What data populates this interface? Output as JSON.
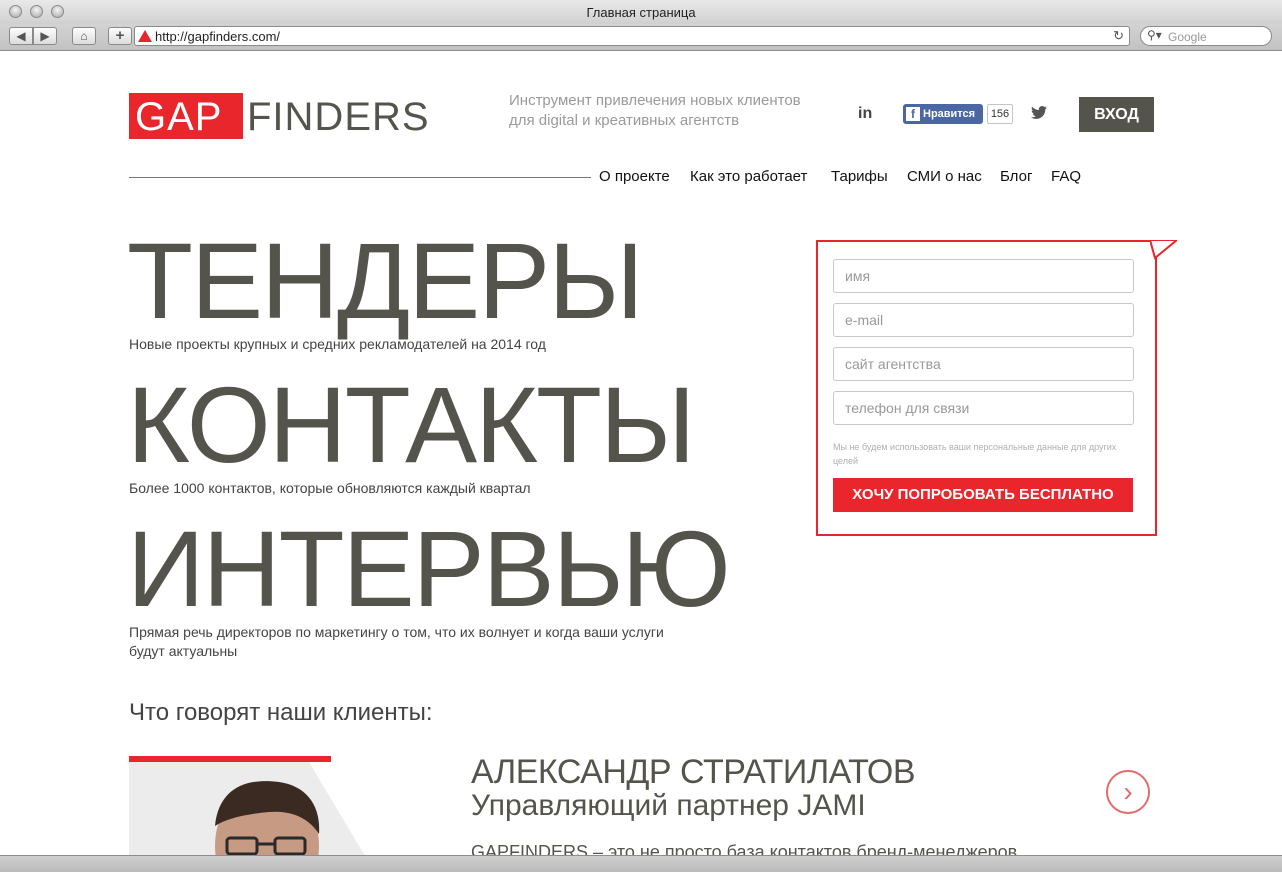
{
  "browser": {
    "window_title": "Главная страница",
    "url": "http://gapfinders.com/",
    "search_placeholder": "Google"
  },
  "header": {
    "logo_gap": "GAP",
    "logo_finders": "FINDERS",
    "tagline": "Инструмент привлечения новых клиентов для digital и креативных агентств",
    "linkedin_label": "in",
    "fb_like_label": "Нравится",
    "fb_count": "156",
    "login_label": "ВХОД"
  },
  "nav": {
    "items": [
      "О проекте",
      "Как это работает",
      "Тарифы",
      "СМИ о нас",
      "Блог",
      "FAQ"
    ]
  },
  "hero": {
    "word1": "ТЕНДЕРЫ",
    "sub1": "Новые проекты крупных и средних рекламодателей на 2014 год",
    "word2": "КОНТАКТЫ",
    "sub2": "Более 1000 контактов, которые обновляются каждый квартал",
    "word3": "ИНТЕРВЬЮ",
    "sub3": "Прямая речь директоров по маркетингу о том, что их волнует и когда ваши услуги будут актуальны"
  },
  "form": {
    "name_placeholder": "имя",
    "email_placeholder": "e-mail",
    "site_placeholder": "сайт агентства",
    "phone_placeholder": "телефон для связи",
    "privacy": "Мы не будем использовать ваши персональные данные для других целей",
    "submit_label": "ХОЧУ ПОПРОБОВАТЬ БЕСПЛАТНО"
  },
  "testimonials": {
    "title": "Что говорят наши клиенты:",
    "name": "АЛЕКСАНДР СТРАТИЛАТОВ",
    "role": "Управляющий партнер JAMI",
    "quote": "GAPFINDERS – это не просто база контактов бренд-менеджеров"
  },
  "colors": {
    "brand_red": "#e8262b",
    "dark": "#55544c"
  }
}
